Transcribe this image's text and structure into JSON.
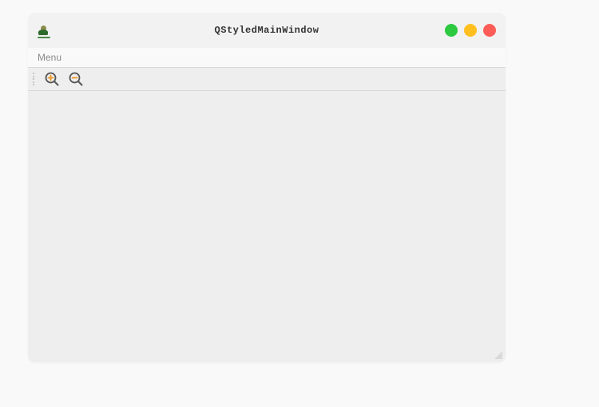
{
  "window": {
    "title": "QStyledMainWindow"
  },
  "menubar": {
    "items": [
      {
        "label": "Menu"
      }
    ]
  },
  "toolbar": {
    "zoom_in_label": "Zoom In",
    "zoom_out_label": "Zoom Out"
  },
  "colors": {
    "green": "#2dc941",
    "yellow": "#ffbf1f",
    "red": "#fe5c56"
  }
}
